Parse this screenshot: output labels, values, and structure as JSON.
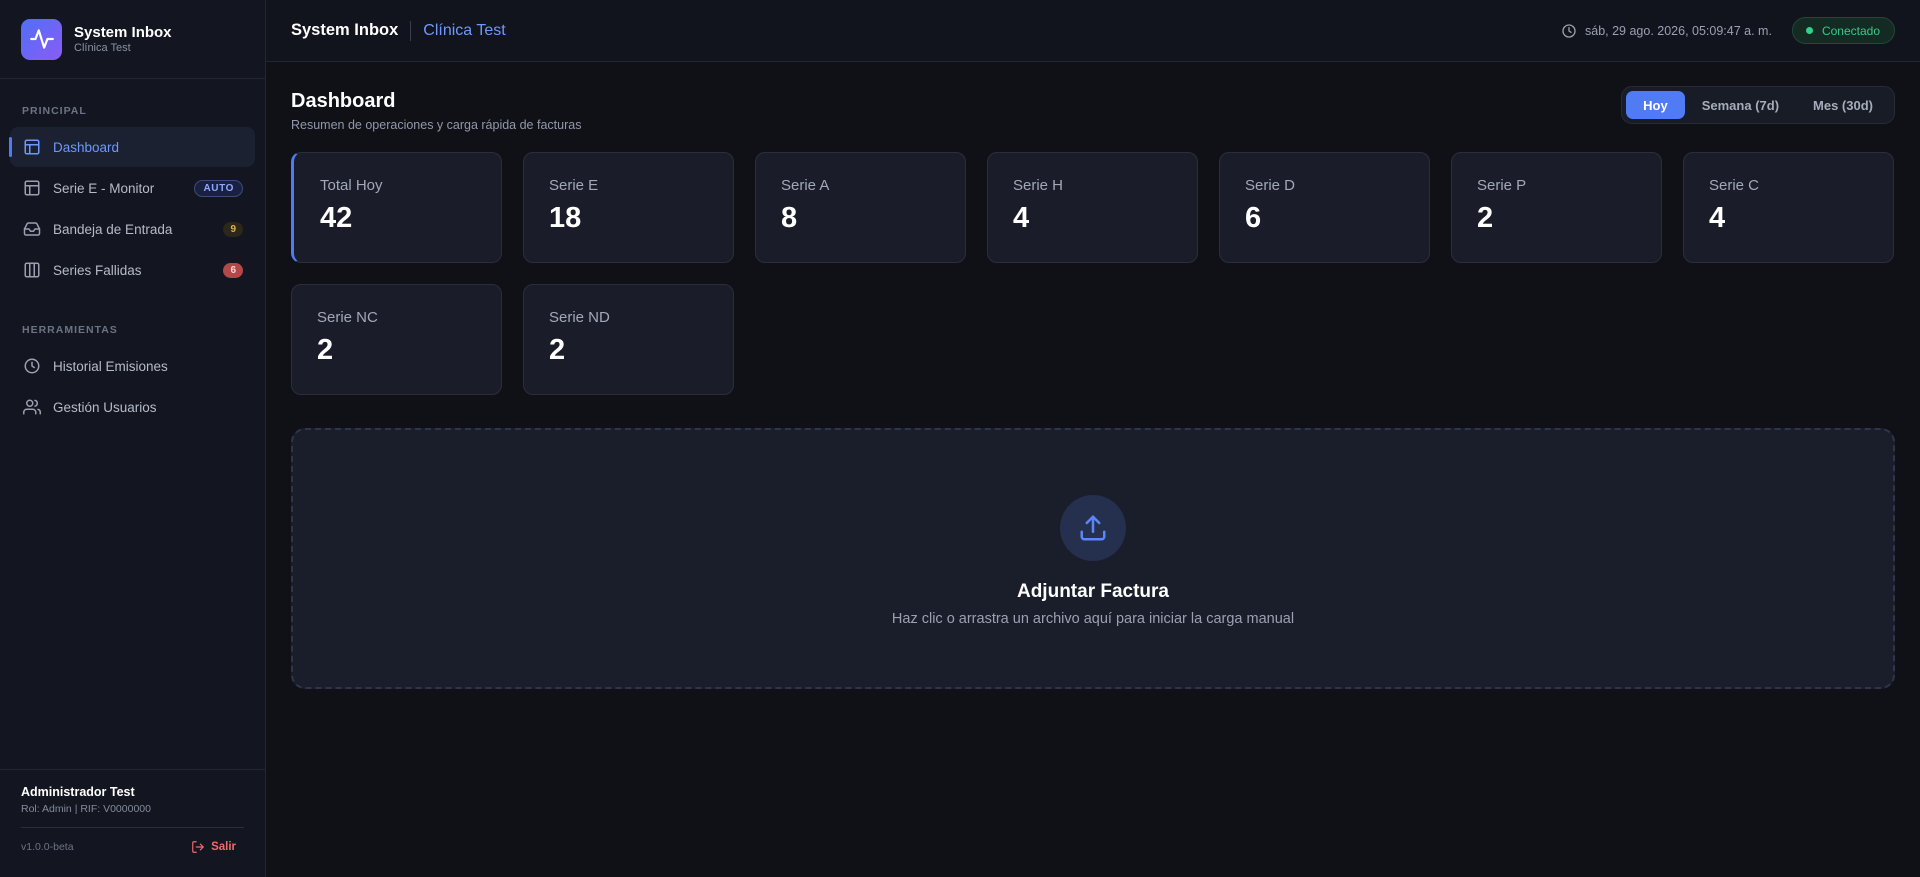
{
  "brand": {
    "title": "System Inbox",
    "subtitle": "Clínica Test"
  },
  "sidebar": {
    "section_main": "PRINCIPAL",
    "section_tools": "HERRAMIENTAS",
    "items": [
      {
        "label": "Dashboard",
        "icon": "layout-icon"
      },
      {
        "label": "Serie E - Monitor",
        "icon": "layout-icon",
        "badge": "AUTO"
      },
      {
        "label": "Bandeja de Entrada",
        "icon": "inbox-icon",
        "count": "9"
      },
      {
        "label": "Series Fallidas",
        "icon": "columns-icon",
        "count": "6"
      }
    ],
    "tools": [
      {
        "label": "Historial Emisiones",
        "icon": "clock-icon"
      },
      {
        "label": "Gestión Usuarios",
        "icon": "users-icon"
      }
    ],
    "user": {
      "name": "Administrador Test",
      "role": "Rol: Admin | RIF: V0000000"
    },
    "version": "v1.0.0-beta",
    "logout": "Salir"
  },
  "topbar": {
    "app": "System Inbox",
    "client": "Clínica Test",
    "datetime": "sáb, 29 ago. 2026, 05:09:47 a. m.",
    "status": "Conectado"
  },
  "page": {
    "title": "Dashboard",
    "subtitle": "Resumen de operaciones y carga rápida de facturas",
    "ranges": [
      "Hoy",
      "Semana (7d)",
      "Mes (30d)"
    ],
    "active_range": "Hoy"
  },
  "cards": [
    {
      "label": "Total Hoy",
      "value": "42"
    },
    {
      "label": "Serie E",
      "value": "18"
    },
    {
      "label": "Serie A",
      "value": "8"
    },
    {
      "label": "Serie H",
      "value": "4"
    },
    {
      "label": "Serie D",
      "value": "6"
    },
    {
      "label": "Serie P",
      "value": "2"
    },
    {
      "label": "Serie C",
      "value": "4"
    },
    {
      "label": "Serie NC",
      "value": "2"
    },
    {
      "label": "Serie ND",
      "value": "2"
    }
  ],
  "upload": {
    "title": "Adjuntar Factura",
    "subtitle": "Haz clic o arrastra un archivo aquí para iniciar la carga manual"
  },
  "colors": {
    "accent": "#4f7bf5",
    "accent_text": "#6f98ff",
    "success": "#2fd38a",
    "danger": "#ef6b6b",
    "warning": "#e0b24a",
    "background": "#0f1117"
  }
}
